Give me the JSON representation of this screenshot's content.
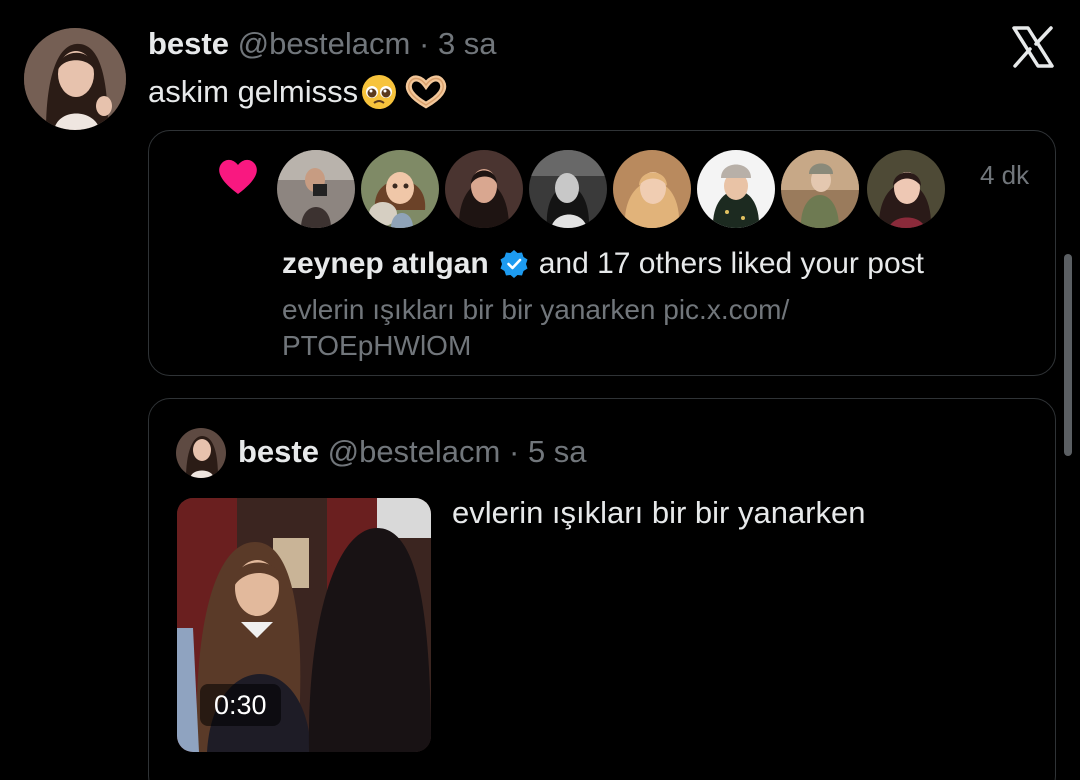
{
  "tweet": {
    "author_name": "beste",
    "handle": "@bestelacm",
    "separator": "·",
    "time": "3 sa",
    "text": "askim gelmisss",
    "emoji_1": "pleading-face-emoji",
    "emoji_2": "heart-hands-emoji"
  },
  "notification": {
    "likers_count_shown": 8,
    "time": "4 dk",
    "liker_name": "zeynep atılgan",
    "liked_text": "and 17 others liked your post",
    "preview_line_1": "evlerin ışıkları bir bir yanarken pic.x.com/",
    "preview_line_2": "PTOEpHWlOM",
    "heart_color": "#f91880"
  },
  "quoted": {
    "author_name": "beste",
    "handle": "@bestelacm",
    "separator": "·",
    "time": "5 sa",
    "text": "evlerin ışıkları bir bir yanarken",
    "video_duration": "0:30"
  },
  "icons": {
    "close": "x-logo-icon",
    "verified": "verified-badge-icon",
    "like": "heart-icon"
  },
  "colors": {
    "background": "#000000",
    "text": "#e7e9ea",
    "muted": "#71767b",
    "border": "#2f3336",
    "verified": "#1d9bf0"
  }
}
